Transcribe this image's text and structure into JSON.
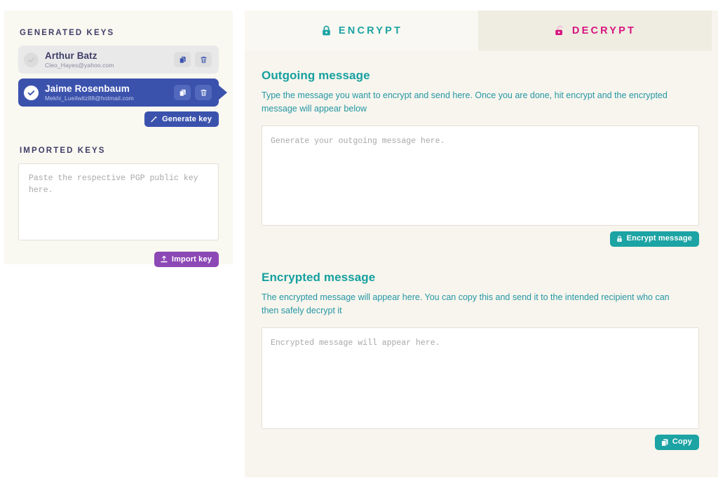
{
  "sidebar": {
    "generated_heading": "GENERATED KEYS",
    "imported_heading": "IMPORTED KEYS",
    "keys": [
      {
        "name": "Arthur Batz",
        "email": "Cleo_Hayes@yahoo.com",
        "selected": false,
        "copy_icon": "copy-icon",
        "delete_icon": "trash-icon"
      },
      {
        "name": "Jaime Rosenbaum",
        "email": "Mekhi_Lueilwitz88@hotmail.com",
        "selected": true,
        "copy_icon": "copy-icon",
        "delete_icon": "trash-icon"
      }
    ],
    "generate_key_label": "Generate key",
    "generate_key_icon": "magic-wand-icon",
    "import_key_label": "Import key",
    "import_key_icon": "upload-icon",
    "imported_placeholder": "Paste the respective PGP public key here.",
    "imported_value": ""
  },
  "tabs": [
    {
      "label": "ENCRYPT",
      "icon": "closed-padlock-icon",
      "active": true,
      "color": "#1ca3a3"
    },
    {
      "label": "DECRYPT",
      "icon": "open-padlock-icon",
      "active": false,
      "color": "#d6147f"
    }
  ],
  "outgoing": {
    "title": "Outgoing message",
    "description": "Type the message you want to encrypt and send here. Once you are done, hit encrypt and the encrypted message will appear below",
    "placeholder": "Generate your outgoing message here.",
    "value": "",
    "button_label": "Encrypt message",
    "button_icon": "lock-icon"
  },
  "encrypted": {
    "title": "Encrypted message",
    "description": "The encrypted message will appear here. You can copy this and send it to the intended recipient who can then safely decrypt it",
    "placeholder": "Encrypted message will appear here.",
    "value": "",
    "button_label": "Copy",
    "button_icon": "copy-icon"
  },
  "colors": {
    "accent_teal": "#1ca3a3",
    "accent_pink": "#d6147f",
    "accent_indigo": "#3b52ad",
    "accent_purple": "#8c48b5",
    "panel_bg": "#f7f5ed",
    "sidebar_bg": "#f9f8f1"
  }
}
